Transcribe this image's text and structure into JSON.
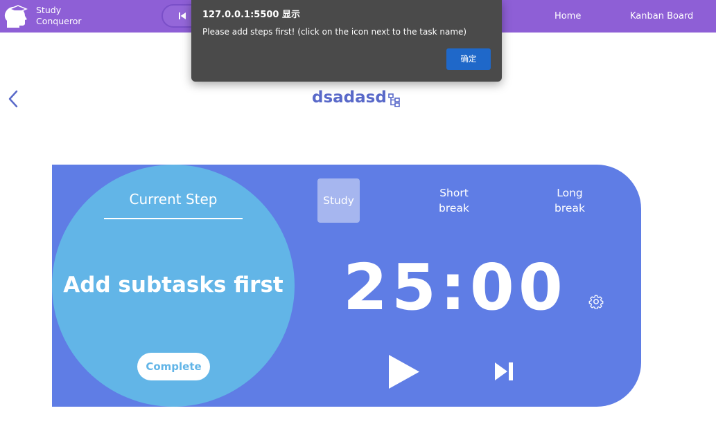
{
  "navbar": {
    "brand_line1": "Study",
    "brand_line2": "Conqueror",
    "links": [
      "Home",
      "Kanban Board"
    ]
  },
  "task": {
    "title": "dsadasd"
  },
  "current_step": {
    "heading": "Current Step",
    "text": "Add subtasks first",
    "complete_label": "Complete"
  },
  "modes": {
    "study": "Study",
    "short_line1": "Short",
    "short_line2": "break",
    "long_line1": "Long",
    "long_line2": "break",
    "active": "Study"
  },
  "timer": {
    "display": "25:00"
  },
  "dialog": {
    "title": "127.0.0.1:5500 显示",
    "message": "Please add steps first! (click on the icon next to the task name)",
    "ok_label": "确定"
  },
  "colors": {
    "navbar": "#8e5fd6",
    "card": "#5f7de5",
    "circle": "#62b5e7",
    "title": "#5969c9",
    "dialog_bg": "#4a4a4a",
    "dialog_button": "#1f68c9"
  },
  "icons": [
    "head-logo-icon",
    "skip-previous-icon",
    "back-chevron-icon",
    "steps-tree-icon",
    "gear-icon",
    "play-icon",
    "skip-next-icon"
  ]
}
